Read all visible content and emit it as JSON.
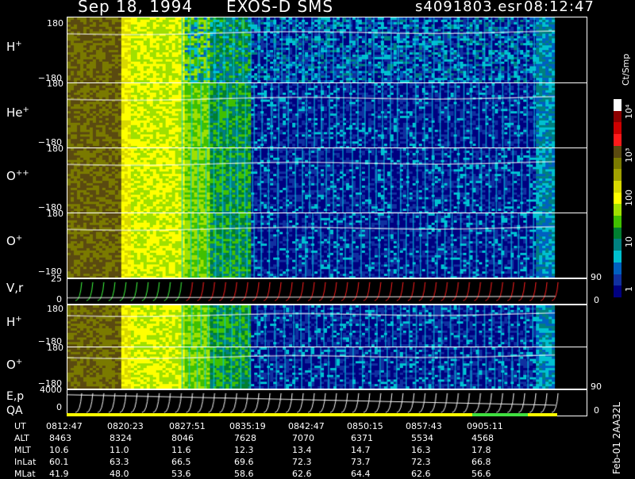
{
  "header": {
    "date": "Sep 18, 1994",
    "instrument": "EXOS-D SMS",
    "file": "s4091803.esr",
    "time": "08:12:47"
  },
  "panels": [
    {
      "label_main": "H",
      "label_sup": "+",
      "top_tick": "180",
      "bottom_tick": "−180"
    },
    {
      "label_main": "He",
      "label_sup": "+",
      "top_tick": "180",
      "bottom_tick": "−180"
    },
    {
      "label_main": "O",
      "label_sup": "++",
      "top_tick": "180",
      "bottom_tick": "−180"
    },
    {
      "label_main": "O",
      "label_sup": "+",
      "top_tick": "180",
      "bottom_tick": "−180"
    }
  ],
  "vr_panel": {
    "label": "V,r",
    "top_tick": "25",
    "bottom_tick": "0",
    "right_top": "90",
    "right_bottom": "0"
  },
  "lower_panels": [
    {
      "label_main": "H",
      "label_sup": "+",
      "top_tick": "180",
      "bottom_tick": "−180"
    },
    {
      "label_main": "O",
      "label_sup": "+",
      "top_tick": "180",
      "bottom_tick": "−180"
    }
  ],
  "ep_panel": {
    "label1": "E,p",
    "label2": "QA",
    "top_tick": "4000",
    "bottom_tick": "0",
    "right_top": "90",
    "right_bottom": "0"
  },
  "colorbar": {
    "units": "Ct/Smp",
    "labels": [
      "10⁴",
      "10³",
      "100",
      "10",
      "1"
    ],
    "colors": [
      "#ffffff",
      "#8b0000",
      "#cc0000",
      "#ff1a1a",
      "#5a4a10",
      "#7a7a00",
      "#a0a000",
      "#d8d800",
      "#ffff00",
      "#a0e000",
      "#40c000",
      "#008030",
      "#008080",
      "#00c0d0",
      "#0060c0",
      "#1030a0",
      "#000080"
    ]
  },
  "side_note": "Feb-01  2AA32L",
  "table": {
    "rows": [
      {
        "name": "UT",
        "values": [
          "0812:47",
          "0820:23",
          "0827:51",
          "0835:19",
          "0842:47",
          "0850:15",
          "0857:43",
          "0905:11"
        ]
      },
      {
        "name": "ALT",
        "values": [
          "8463",
          "8324",
          "8046",
          "7628",
          "7070",
          "6371",
          "5534",
          "4568"
        ]
      },
      {
        "name": "MLT",
        "values": [
          "10.6",
          "11.0",
          "11.6",
          "12.3",
          "13.4",
          "14.7",
          "16.3",
          "17.8"
        ]
      },
      {
        "name": "InLat",
        "values": [
          "60.1",
          "63.3",
          "66.5",
          "69.6",
          "72.3",
          "73.7",
          "72.3",
          "66.8"
        ]
      },
      {
        "name": "MLat",
        "values": [
          "41.9",
          "48.0",
          "53.6",
          "58.6",
          "62.6",
          "64.4",
          "62.6",
          "56.6"
        ]
      }
    ]
  },
  "chart_data": {
    "type": "heatmap",
    "title": "Sep 18, 1994   EXOS-D SMS",
    "x_ticks": [
      "0812:47",
      "0820:23",
      "0827:51",
      "0835:19",
      "0842:47",
      "0850:15",
      "0857:43",
      "0905:11"
    ],
    "series": [
      {
        "name": "H+"
      },
      {
        "name": "He+"
      },
      {
        "name": "O++"
      },
      {
        "name": "O+"
      },
      {
        "name": "V,r"
      },
      {
        "name": "H+"
      },
      {
        "name": "O+"
      },
      {
        "name": "E,p"
      }
    ],
    "ylim": [
      -180,
      180
    ],
    "colorbar_ticks": [
      "1",
      "10",
      "100",
      "10³",
      "10⁴"
    ]
  }
}
